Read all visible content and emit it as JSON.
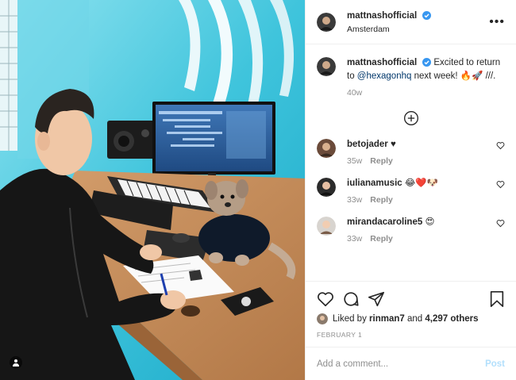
{
  "header": {
    "username": "mattnashofficial",
    "location": "Amsterdam",
    "more_icon": "ellipsis-icon"
  },
  "caption": {
    "username": "mattnashofficial",
    "text_before": "Excited to return to ",
    "mention": "@hexagonhq",
    "text_after": " next week! 🔥🚀 ///.",
    "time": "40w"
  },
  "load_more_icon": "plus-circle-icon",
  "comments": [
    {
      "username": "betojader",
      "text": "♥",
      "time": "35w",
      "reply": "Reply"
    },
    {
      "username": "iulianamusic",
      "text": "😂❤️🐶",
      "time": "33w",
      "reply": "Reply"
    },
    {
      "username": "mirandacaroline5",
      "text": "😍",
      "time": "33w",
      "reply": "Reply"
    }
  ],
  "actions": {
    "like_icon": "heart-icon",
    "comment_icon": "comment-icon",
    "share_icon": "share-icon",
    "save_icon": "bookmark-icon"
  },
  "likes": {
    "prefix": "Liked by ",
    "user": "rinman7",
    "middle": " and ",
    "count": "4,297 others"
  },
  "date": "FEBRUARY 1",
  "add_comment": {
    "placeholder": "Add a comment...",
    "post_label": "Post"
  },
  "colors": {
    "verified": "#3897f0",
    "mention": "#00376b",
    "muted": "#8e8e8e",
    "post_disabled": "#b2dffc"
  }
}
